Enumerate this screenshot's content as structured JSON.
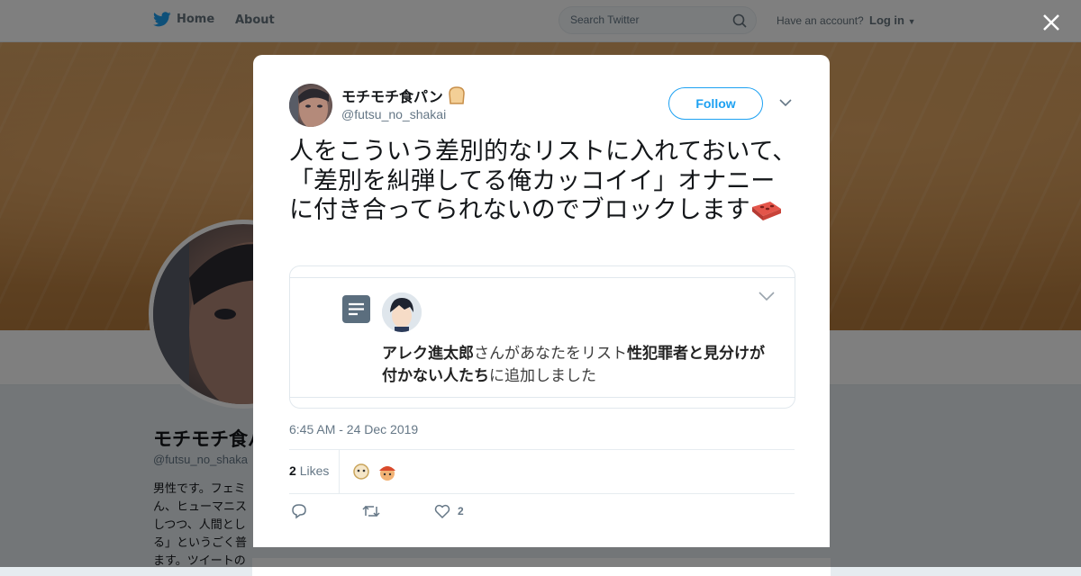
{
  "topbar": {
    "home_label": "Home",
    "about_label": "About",
    "search_placeholder": "Search Twitter",
    "account_question": "Have an account?",
    "login_label": "Log in"
  },
  "profile": {
    "name": "モチモチ食パ",
    "handle": "@futsu_no_shaka",
    "bio_lines": [
      "男性です。フェミ",
      "ん、ヒューマニス",
      "しつつ、人間とし",
      "る」というごく普",
      "ます。ツイートの"
    ]
  },
  "tweet": {
    "author_name": "モチモチ食パン",
    "author_emoji": "bread-emoji",
    "author_handle": "@futsu_no_shakai",
    "follow_label": "Follow",
    "text": "人をこういう差別的なリストに入れておいて、「差別を糾弾してる俺カッコイイ」オナニーに付き合ってられないのでブロックします",
    "text_emoji": "brick-emoji",
    "embed": {
      "list_user": "アレク進太郎",
      "middle_text": "さんがあなたをリスト",
      "list_name": "性犯罪者と見分けが付かない人たち",
      "suffix": "に追加しました"
    },
    "timestamp": "6:45 AM - 24 Dec 2019",
    "likes_count": "2",
    "likes_label": "Likes",
    "like_action_count": "2"
  },
  "colors": {
    "accent": "#1da1f2",
    "text_primary": "#14171a",
    "text_secondary": "#657786",
    "border": "#e6ecf0"
  }
}
